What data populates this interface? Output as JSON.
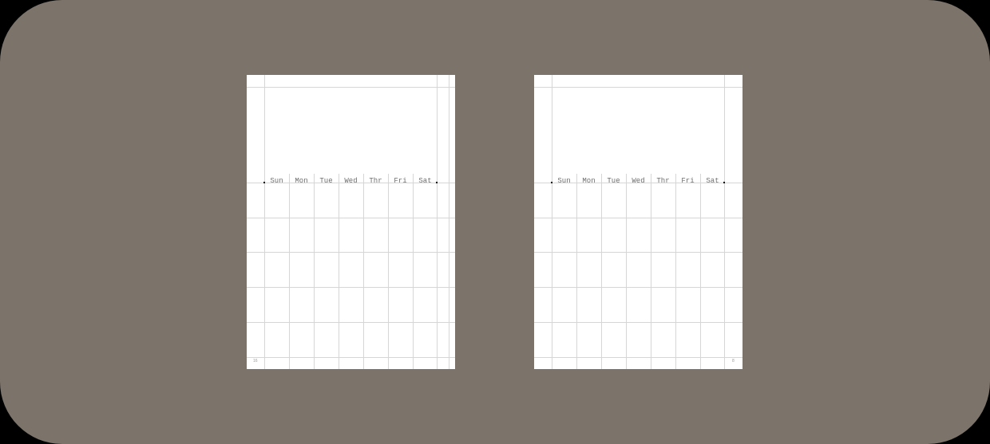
{
  "pages": [
    {
      "side": "left",
      "weekdays": [
        "Sun",
        "Mon",
        "Tue",
        "Wed",
        "Thr",
        "Fri",
        "Sat"
      ],
      "page_number": "16"
    },
    {
      "side": "right",
      "weekdays": [
        "Sun",
        "Mon",
        "Tue",
        "Wed",
        "Thr",
        "Fri",
        "Sat"
      ],
      "page_number": "8"
    }
  ],
  "colors": {
    "background": "#7c736a",
    "page": "#ffffff",
    "grid": "#d6d6d6",
    "text": "#6e6e6e"
  }
}
